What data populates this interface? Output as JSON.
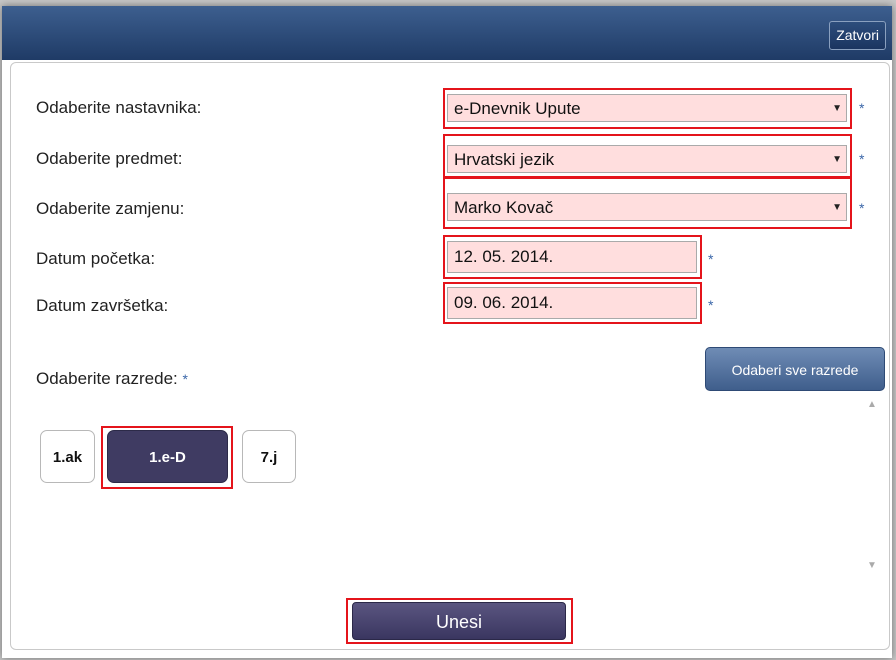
{
  "dialog": {
    "close_label": "Zatvori"
  },
  "form": {
    "teacher_label": "Odaberite nastavnika:",
    "teacher_value": "e-Dnevnik Upute",
    "subject_label": "Odaberite predmet:",
    "subject_value": "Hrvatski jezik",
    "substitute_label": "Odaberite zamjenu:",
    "substitute_value": "Marko Kovač",
    "start_label": "Datum početka:",
    "start_value": "12. 05. 2014.",
    "end_label": "Datum završetka:",
    "end_value": "09. 06. 2014.",
    "classes_label": "Odaberite razrede:",
    "select_all_label": "Odaberi sve razrede",
    "required_mark": "*",
    "dropdown_caret": "▼",
    "submit_label": "Unesi"
  },
  "classes": [
    {
      "label": "1.ak",
      "selected": false
    },
    {
      "label": "1.e-D",
      "selected": true
    },
    {
      "label": "7.j",
      "selected": false
    }
  ],
  "scroll": {
    "up_glyph": "▲",
    "down_glyph": "▼"
  },
  "colors": {
    "titlebar": "#1f3b66",
    "highlight": "#e4141b",
    "field_bg": "#ffdede",
    "active_chip": "#3f3b62"
  }
}
